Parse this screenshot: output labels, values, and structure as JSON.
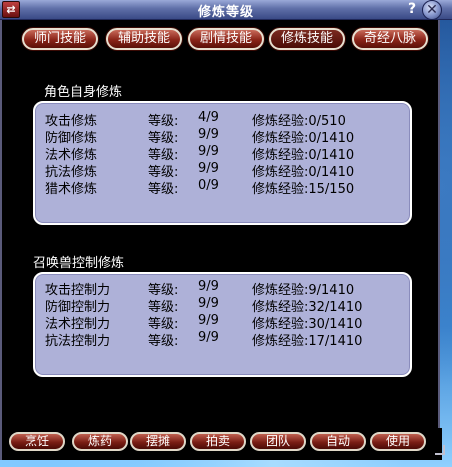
{
  "window": {
    "title": "修炼等级",
    "menu_icon": "⇄",
    "help": "?",
    "close": "✕"
  },
  "tabs": [
    {
      "label": "师门技能"
    },
    {
      "label": "辅助技能"
    },
    {
      "label": "剧情技能"
    },
    {
      "label": "修炼技能",
      "active": true
    },
    {
      "label": "奇经八脉"
    }
  ],
  "self_cultivation": {
    "title": "角色自身修炼",
    "rows": [
      {
        "name": "攻击修炼",
        "level_label": "等级:",
        "level": "4/9",
        "exp": "修炼经验:0/510"
      },
      {
        "name": "防御修炼",
        "level_label": "等级:",
        "level": "9/9",
        "exp": "修炼经验:0/1410"
      },
      {
        "name": "法术修炼",
        "level_label": "等级:",
        "level": "9/9",
        "exp": "修炼经验:0/1410"
      },
      {
        "name": "抗法修炼",
        "level_label": "等级:",
        "level": "9/9",
        "exp": "修炼经验:0/1410"
      },
      {
        "name": "猎术修炼",
        "level_label": "等级:",
        "level": "0/9",
        "exp": "修炼经验:15/150"
      }
    ]
  },
  "pet_cultivation": {
    "title": "召唤兽控制修炼",
    "rows": [
      {
        "name": "攻击控制力",
        "level_label": "等级:",
        "level": "9/9",
        "exp": "修炼经验:9/1410"
      },
      {
        "name": "防御控制力",
        "level_label": "等级:",
        "level": "9/9",
        "exp": "修炼经验:32/1410"
      },
      {
        "name": "法术控制力",
        "level_label": "等级:",
        "level": "9/9",
        "exp": "修炼经验:30/1410"
      },
      {
        "name": "抗法控制力",
        "level_label": "等级:",
        "level": "9/9",
        "exp": "修炼经验:17/1410"
      }
    ]
  },
  "bottom_buttons": [
    {
      "label": "烹饪"
    },
    {
      "label": "炼药"
    },
    {
      "label": "摆摊"
    },
    {
      "label": "拍卖"
    },
    {
      "label": "团队"
    },
    {
      "label": "自动"
    },
    {
      "label": "使用"
    }
  ],
  "colors": {
    "panel": "#aeb1d8",
    "tab_button": "#8a2418",
    "title_bar": "#5f6fa8"
  }
}
